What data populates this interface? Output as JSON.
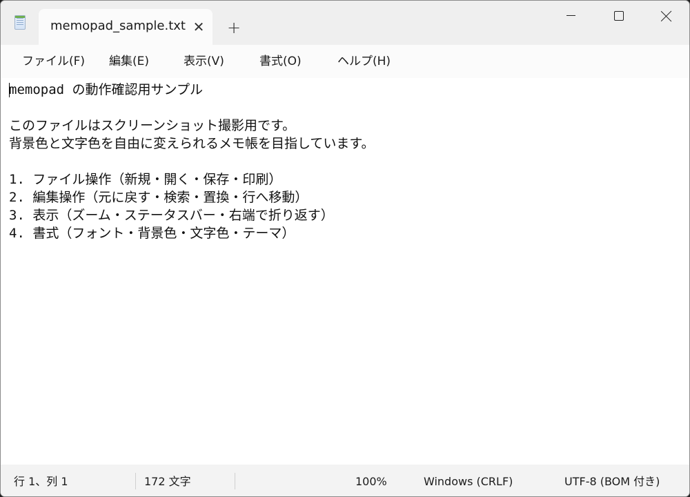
{
  "window": {
    "tab_title": "memopad_sample.txt",
    "tab_close_symbol": "✕",
    "new_tab_symbol": "+",
    "controls": [
      "minimize",
      "maximize",
      "close"
    ]
  },
  "menu": {
    "items": [
      {
        "label": "ファイル(F)"
      },
      {
        "label": "編集(E)"
      },
      {
        "label": "表示(V)"
      },
      {
        "label": "書式(O)"
      },
      {
        "label": "ヘルプ(H)"
      }
    ]
  },
  "editor": {
    "lines": [
      "memopad の動作確認用サンプル",
      "",
      "このファイルはスクリーンショット撮影用です。",
      "背景色と文字色を自由に変えられるメモ帳を目指しています。",
      "",
      "1. ファイル操作（新規・開く・保存・印刷）",
      "2. 編集操作（元に戻す・検索・置換・行へ移動）",
      "3. 表示（ズーム・ステータスバー・右端で折り返す）",
      "4. 書式（フォント・背景色・文字色・テーマ）"
    ]
  },
  "status": {
    "position": "行 1、列 1",
    "char_count": "172 文字",
    "zoom": "100%",
    "line_ending": "Windows (CRLF)",
    "encoding": "UTF-8 (BOM 付き)"
  },
  "colors": {
    "titlebar_bg": "#efefef",
    "tab_bg": "#fbfbfb",
    "editor_bg": "#ffffff",
    "statusbar_bg": "#f3f3f3",
    "text": "#1b1b1b"
  },
  "icons": {
    "app": "notepad-icon",
    "tab_close": "close-icon",
    "new_tab": "plus-icon",
    "minimize": "minimize-icon",
    "maximize": "maximize-icon",
    "close": "close-icon"
  }
}
